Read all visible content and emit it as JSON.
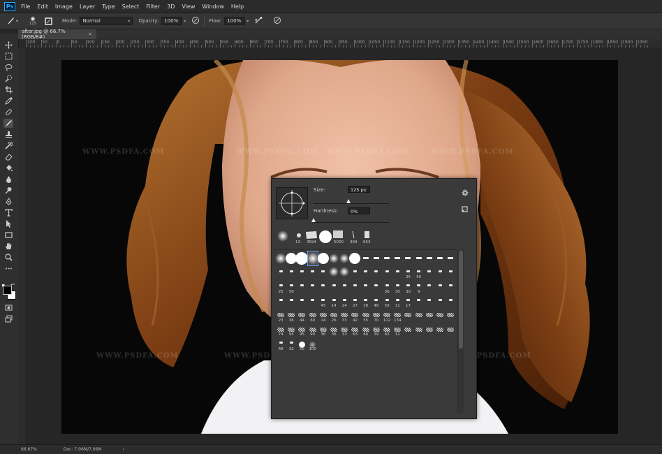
{
  "app": {
    "logo": "Ps",
    "menu": [
      "File",
      "Edit",
      "Image",
      "Layer",
      "Type",
      "Select",
      "Filter",
      "3D",
      "View",
      "Window",
      "Help"
    ]
  },
  "options": {
    "brush_size": "125",
    "mode_label": "Mode:",
    "mode_value": "Normal",
    "opacity_label": "Opacity:",
    "opacity_value": "100%",
    "flow_label": "Flow:",
    "flow_value": "100%"
  },
  "document": {
    "tab_title": "after.jpg @ 66.7% (RGB/8#)",
    "close": "×"
  },
  "ruler": {
    "h_labels": [
      "100",
      "50",
      "0",
      "50",
      "100",
      "150",
      "200",
      "250",
      "300",
      "350",
      "400",
      "450",
      "500",
      "550",
      "600",
      "650",
      "700",
      "750",
      "800",
      "850",
      "900",
      "950",
      "1000",
      "1050",
      "1100",
      "1150",
      "1200",
      "1250",
      "1300",
      "1350",
      "1400",
      "1450",
      "1500",
      "1550",
      "1600",
      "1650",
      "1700",
      "1750",
      "1800",
      "1850",
      "1900",
      "1950"
    ]
  },
  "brush_picker": {
    "size_label": "Size:",
    "size_value": "125 px",
    "size_fraction": 0.16,
    "hardness_label": "Hardness:",
    "hardness_value": "0%",
    "hardness_fraction": 0.0,
    "recent_labels": [
      "13",
      "3594",
      "",
      "5000",
      "399",
      "653"
    ],
    "rows": [
      [
        "",
        "",
        "",
        "",
        "",
        "",
        "",
        "",
        "",
        "",
        "",
        "",
        "",
        "",
        "",
        "",
        ""
      ],
      [
        "",
        "",
        "",
        "",
        "",
        "",
        "",
        "",
        "",
        "",
        "",
        "",
        "25",
        "50",
        "",
        "",
        ""
      ],
      [
        "25",
        "50",
        "",
        "",
        "",
        "",
        "",
        "",
        "",
        "",
        "36",
        "30",
        "30",
        "9",
        "",
        "",
        ""
      ],
      [
        "",
        "",
        "",
        "",
        "45",
        "14",
        "24",
        "27",
        "39",
        "46",
        "59",
        "11",
        "17",
        "",
        "",
        "",
        ""
      ],
      [
        "23",
        "36",
        "44",
        "60",
        "14",
        "26",
        "33",
        "42",
        "55",
        "70",
        "112",
        "134",
        "",
        "",
        "",
        "",
        ""
      ],
      [
        "74",
        "95",
        "95",
        "90",
        "36",
        "36",
        "33",
        "63",
        "66",
        "39",
        "63",
        "11",
        "",
        "",
        "",
        "",
        ""
      ],
      [
        "48",
        "32",
        "55",
        "100",
        "",
        "",
        "",
        "",
        "",
        "",
        "",
        "",
        "",
        "",
        "",
        "",
        ""
      ]
    ]
  },
  "status": {
    "zoom": "66.67%",
    "doc_info": "Doc: 7.06M/7.06M",
    "arrow": "›"
  },
  "watermark": "WWW.PSDFA.COM",
  "colors": {
    "accent": "#31a8ff",
    "hair": "#8a4818",
    "skin": "#e6b094"
  }
}
